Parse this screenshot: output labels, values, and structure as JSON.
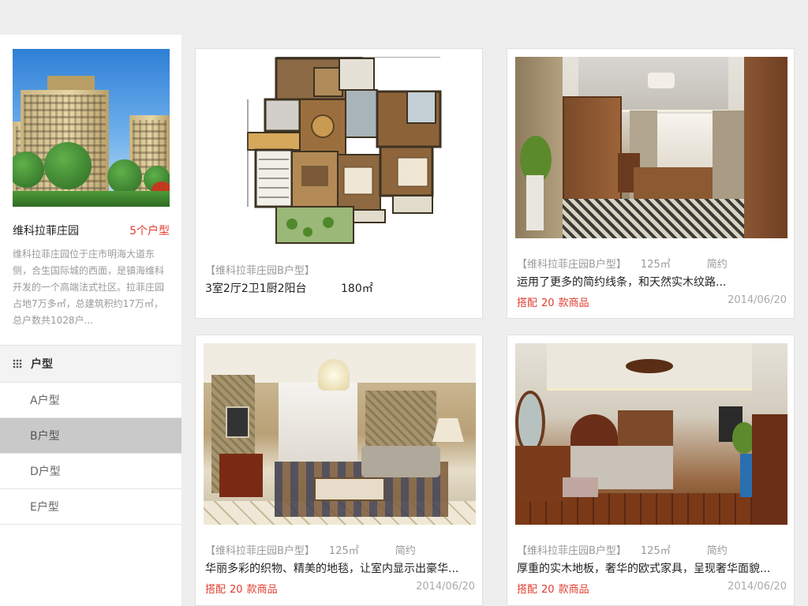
{
  "estate": {
    "name": "维科拉菲庄园",
    "count_label": "5个户型",
    "description": "维科拉菲庄园位于庄市明海大道东侧，合生国际城的西面，是镇海维科开发的一个高端法式社区。拉菲庄园占地7万多㎡，总建筑积约17万㎡，总户数共1028户..."
  },
  "menu": {
    "header": "户型",
    "items": [
      {
        "label": "A户型",
        "active": false
      },
      {
        "label": "B户型",
        "active": true
      },
      {
        "label": "D户型",
        "active": false
      },
      {
        "label": "E户型",
        "active": false
      }
    ]
  },
  "cards": [
    {
      "tag": "【维科拉菲庄园B户型】",
      "rooms": "3室2厅2卫1厨2阳台",
      "area": "180㎡"
    },
    {
      "tag": "【维科拉菲庄园B户型】",
      "area": "125㎡",
      "style": "简约",
      "desc": "运用了更多的简约线条，和天然实木纹路...",
      "match_prefix": "搭配",
      "match_count": "20",
      "match_suffix": "款商品",
      "date": "2014/06/20"
    },
    {
      "tag": "【维科拉菲庄园B户型】",
      "area": "125㎡",
      "style": "简约",
      "desc": "华丽多彩的织物、精美的地毯，让室内显示出豪华...",
      "match_prefix": "搭配",
      "match_count": "20",
      "match_suffix": "款商品",
      "date": "2014/06/20"
    },
    {
      "tag": "【维科拉菲庄园B户型】",
      "area": "125㎡",
      "style": "简约",
      "desc": "厚重的实木地板，奢华的欧式家具，呈现奢华面貌...",
      "match_prefix": "搭配",
      "match_count": "20",
      "match_suffix": "款商品",
      "date": "2014/06/20"
    }
  ],
  "icons": {
    "menu_header_icon": "grid-dots-icon"
  },
  "colors": {
    "accent": "#e03c2e",
    "active_menu_bg": "#c9c9c9",
    "page_bg": "#eeeeee"
  }
}
